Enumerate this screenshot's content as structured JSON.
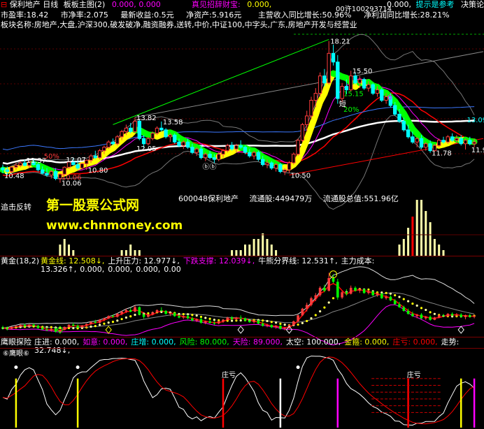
{
  "colors": {
    "up": "#ff3c3c",
    "down": "#00ffff",
    "gold": "#ffff00",
    "green": "#00ff00",
    "white": "#ffffff",
    "magenta": "#ff00ff",
    "red": "#ff0000",
    "yellow": "#ffff00",
    "blue": "#3c78ff"
  },
  "title": {
    "stock": "保利地产",
    "period": "日线",
    "indicator": "板板主图(2)",
    "p1": "0.000,",
    "p2": "0.000",
    "mid": "真见招辞财宝:",
    "code": "0.000,",
    "r1": "0.000,",
    "hint": "提示是参考",
    "right": "决策论"
  },
  "info1": {
    "pe": "市盈率:18.42",
    "pb": "市净率:2.075",
    "eps": "最新收益:0.5元",
    "nav": "净资产:5.916元",
    "rev": "主营收入同比增长:50.96%",
    "profit": "净利润同比增长:28.21%",
    "extra": "00许100293714"
  },
  "info2": "板块名称:房地产,大盘,沪深300,破发破净,融资融券,送转,中价,中证100,中字头,广东,房地产开发与经营业",
  "watermark": {
    "brand": "第一股票公式网",
    "url": "www.chnmoney.com"
  },
  "stockinfo": {
    "code": "600048保利地产",
    "float": "流通股:449479万",
    "cap": "流通股总值:551.96亿"
  },
  "vol_label": "追击反转",
  "gold_panel": {
    "label": "黄金(18,2)",
    "items": [
      {
        "t": "黄金线: 12.508↓,",
        "c": "#ffff00"
      },
      {
        "t": "上升压力: 12.977↓,",
        "c": "#ffffff"
      },
      {
        "t": "下跌支撑: 12.039↓,",
        "c": "#ff00ff"
      },
      {
        "t": "牛熊分界线: 12.531↑,",
        "c": "#ffffff"
      },
      {
        "t": "主力成本: 13.326↑,",
        "c": "#ffffff"
      },
      {
        "t": "0.000,",
        "c": "#ffffff"
      },
      {
        "t": "0.000,",
        "c": "#ffffff"
      },
      {
        "t": "0.000,",
        "c": "#ffffff"
      },
      {
        "t": "0.00",
        "c": "#ffffff"
      }
    ]
  },
  "eagle_panel": {
    "label": "鹰眼探险",
    "items": [
      {
        "t": "庄进: 0.000,",
        "c": "#ffffff"
      },
      {
        "t": "如意: 0.000,",
        "c": "#ff00ff"
      },
      {
        "t": "庄增: 0.000,",
        "c": "#00ffff"
      },
      {
        "t": "风险: 80.000,",
        "c": "#00ff00"
      },
      {
        "t": "天险: 89.000,",
        "c": "#ff00ff"
      },
      {
        "t": "太空: 100.000,",
        "c": "#ffffff"
      },
      {
        "t": "金箍: 0.000,",
        "c": "#ffff00"
      },
      {
        "t": "庄亏: 0.000,",
        "c": "#ff0000"
      },
      {
        "t": "走势: 32.748↓,",
        "c": "#ffffff"
      }
    ]
  },
  "eagle_label": "⑥鹰眼⑥",
  "chart_data": [
    {
      "type": "candlestick",
      "title": "保利地产 日线",
      "ylim": [
        10.2,
        18.8
      ],
      "annotations": [
        {
          "x": 0,
          "y": 10.48,
          "text": "10.48",
          "color": "#ffffff"
        },
        {
          "x": 5,
          "y": 11.37,
          "text": "11.37",
          "color": "#ffffff"
        },
        {
          "x": 9,
          "y": 11.6,
          "text": "50%",
          "color": "#ff3c3c"
        },
        {
          "x": 13,
          "y": 10.06,
          "text": "10.06",
          "color": "#ffffff"
        },
        {
          "x": 13,
          "y": 10.4,
          "text": "10.06",
          "color": "#ff3c3c"
        },
        {
          "x": 14,
          "y": 11.4,
          "text": "12.07",
          "color": "#ffffff"
        },
        {
          "x": 19,
          "y": 10.8,
          "text": "10.80",
          "color": "#ffffff"
        },
        {
          "x": 30,
          "y": 13.82,
          "text": "13.82",
          "color": "#ffffff"
        },
        {
          "x": 30,
          "y": 12.05,
          "text": "12.05",
          "color": "#ffffff"
        },
        {
          "x": 36,
          "y": 13.58,
          "text": "13.58",
          "color": "#ffffff"
        },
        {
          "x": 45,
          "y": 11.0,
          "text": "ⓑⓑ",
          "color": "#ffffff"
        },
        {
          "x": 65,
          "y": 10.5,
          "text": "10.50",
          "color": "#ffffff"
        },
        {
          "x": 74,
          "y": 18.21,
          "text": "18.21",
          "color": "#ffffff"
        },
        {
          "x": 76,
          "y": 14.6,
          "text": "短",
          "color": "#ffffff"
        },
        {
          "x": 77,
          "y": 15.2,
          "text": "15.15",
          "color": "#00ff00"
        },
        {
          "x": 77,
          "y": 14.3,
          "text": "20%",
          "color": "#00ff00"
        },
        {
          "x": 79,
          "y": 16.5,
          "text": "15.50",
          "color": "#ffffff"
        },
        {
          "x": 87,
          "y": 15.0,
          "text": "0",
          "color": "#ff00ff"
        },
        {
          "x": 97,
          "y": 11.78,
          "text": "11.78",
          "color": "#ffffff"
        },
        {
          "x": 105,
          "y": 13.7,
          "text": "13.09",
          "color": "#00ffff"
        },
        {
          "x": 106,
          "y": 11.97,
          "text": "11.97",
          "color": "#ffffff"
        }
      ],
      "series": [
        {
          "name": "",
          "type": "ohlc",
          "values": [
            [
              10.9,
              11.1,
              10.6,
              10.8
            ],
            [
              10.8,
              11.0,
              10.48,
              10.7
            ],
            [
              10.7,
              11.0,
              10.6,
              10.95
            ],
            [
              10.95,
              11.2,
              10.8,
              11.05
            ],
            [
              11.05,
              11.3,
              10.95,
              11.2
            ],
            [
              11.2,
              11.37,
              11.0,
              11.05
            ],
            [
              11.05,
              11.3,
              10.9,
              11.25
            ],
            [
              11.25,
              11.4,
              11.05,
              11.1
            ],
            [
              11.1,
              11.2,
              10.7,
              10.8
            ],
            [
              10.8,
              11.0,
              10.55,
              10.6
            ],
            [
              10.6,
              10.9,
              10.4,
              10.5
            ],
            [
              10.5,
              10.8,
              10.3,
              10.7
            ],
            [
              10.7,
              10.9,
              10.2,
              10.3
            ],
            [
              10.3,
              10.6,
              10.06,
              10.55
            ],
            [
              10.55,
              11.0,
              10.5,
              10.95
            ],
            [
              10.95,
              11.3,
              10.85,
              11.25
            ],
            [
              11.25,
              11.5,
              11.05,
              11.1
            ],
            [
              11.1,
              11.3,
              10.8,
              10.9
            ],
            [
              10.9,
              11.2,
              10.8,
              11.15
            ],
            [
              11.15,
              11.4,
              10.8,
              11.35
            ],
            [
              11.35,
              11.7,
              11.2,
              11.6
            ],
            [
              11.6,
              11.9,
              11.4,
              11.5
            ],
            [
              11.5,
              12.0,
              11.4,
              11.9
            ],
            [
              11.9,
              12.2,
              11.7,
              12.1
            ],
            [
              12.1,
              12.5,
              12.0,
              12.4
            ],
            [
              12.4,
              12.6,
              12.2,
              12.3
            ],
            [
              12.3,
              12.8,
              12.2,
              12.7
            ],
            [
              12.7,
              13.1,
              12.5,
              13.0
            ],
            [
              13.0,
              13.4,
              12.8,
              13.2
            ],
            [
              13.2,
              13.5,
              12.9,
              13.0
            ],
            [
              13.0,
              13.82,
              12.9,
              13.6
            ],
            [
              13.6,
              13.7,
              12.5,
              12.6
            ],
            [
              12.6,
              12.8,
              12.05,
              12.3
            ],
            [
              12.3,
              12.7,
              12.2,
              12.6
            ],
            [
              12.6,
              13.0,
              12.5,
              12.9
            ],
            [
              12.9,
              13.3,
              12.8,
              13.2
            ],
            [
              13.2,
              13.58,
              13.0,
              13.1
            ],
            [
              13.1,
              13.2,
              12.6,
              12.7
            ],
            [
              12.7,
              12.9,
              12.4,
              12.8
            ],
            [
              12.8,
              12.9,
              12.3,
              12.4
            ],
            [
              12.4,
              12.6,
              12.1,
              12.2
            ],
            [
              12.2,
              12.5,
              12.0,
              12.4
            ],
            [
              12.4,
              12.6,
              12.0,
              12.1
            ],
            [
              12.1,
              12.3,
              11.7,
              11.8
            ],
            [
              11.8,
              12.1,
              11.6,
              12.0
            ],
            [
              12.0,
              12.2,
              11.4,
              11.5
            ],
            [
              11.5,
              11.8,
              11.3,
              11.7
            ],
            [
              11.7,
              11.9,
              11.4,
              11.5
            ],
            [
              11.5,
              11.7,
              11.2,
              11.4
            ],
            [
              11.4,
              11.8,
              11.3,
              11.7
            ],
            [
              11.7,
              12.0,
              11.5,
              11.9
            ],
            [
              11.9,
              12.3,
              11.8,
              12.2
            ],
            [
              12.2,
              12.4,
              11.9,
              12.0
            ],
            [
              12.0,
              12.3,
              11.8,
              12.2
            ],
            [
              12.2,
              12.5,
              12.0,
              12.1
            ],
            [
              12.1,
              12.2,
              11.7,
              11.8
            ],
            [
              11.8,
              12.0,
              11.5,
              11.6
            ],
            [
              11.6,
              11.9,
              11.4,
              11.8
            ],
            [
              11.8,
              11.9,
              11.3,
              11.4
            ],
            [
              11.4,
              11.6,
              11.0,
              11.1
            ],
            [
              11.1,
              11.4,
              10.9,
              11.2
            ],
            [
              11.2,
              11.3,
              10.8,
              10.9
            ],
            [
              10.9,
              11.2,
              10.7,
              11.1
            ],
            [
              11.1,
              11.2,
              10.6,
              10.7
            ],
            [
              10.7,
              10.9,
              10.5,
              10.8
            ],
            [
              10.8,
              11.3,
              10.6,
              11.2
            ],
            [
              11.2,
              11.8,
              11.1,
              11.7
            ],
            [
              11.7,
              12.6,
              11.6,
              12.5
            ],
            [
              12.5,
              13.5,
              12.4,
              13.4
            ],
            [
              13.4,
              14.2,
              13.0,
              13.9
            ],
            [
              13.9,
              15.0,
              13.7,
              14.8
            ],
            [
              14.8,
              15.5,
              14.4,
              15.2
            ],
            [
              15.2,
              16.4,
              15.0,
              16.2
            ],
            [
              16.2,
              16.6,
              15.6,
              15.8
            ],
            [
              15.8,
              18.21,
              15.7,
              17.5
            ],
            [
              17.5,
              18.0,
              16.8,
              17.0
            ],
            [
              17.0,
              17.4,
              14.6,
              14.9
            ],
            [
              14.9,
              15.8,
              14.7,
              15.6
            ],
            [
              15.6,
              16.0,
              15.15,
              15.4
            ],
            [
              15.4,
              16.5,
              15.3,
              16.2
            ],
            [
              16.2,
              16.4,
              15.7,
              15.8
            ],
            [
              15.8,
              16.2,
              15.5,
              16.0
            ],
            [
              16.0,
              16.1,
              15.4,
              15.5
            ],
            [
              15.5,
              15.9,
              15.3,
              15.7
            ],
            [
              15.7,
              15.8,
              15.1,
              15.2
            ],
            [
              15.2,
              15.6,
              15.0,
              15.4
            ],
            [
              15.4,
              15.5,
              14.7,
              14.8
            ],
            [
              14.8,
              15.2,
              14.6,
              15.0
            ],
            [
              15.0,
              15.2,
              14.4,
              14.5
            ],
            [
              14.5,
              14.7,
              13.9,
              14.0
            ],
            [
              14.0,
              14.3,
              13.5,
              13.6
            ],
            [
              13.6,
              13.8,
              13.0,
              13.1
            ],
            [
              13.1,
              13.4,
              12.6,
              12.7
            ],
            [
              12.7,
              13.0,
              12.3,
              12.4
            ],
            [
              12.4,
              12.7,
              12.1,
              12.6
            ],
            [
              12.6,
              12.8,
              12.0,
              12.1
            ],
            [
              12.1,
              12.4,
              11.9,
              12.3
            ],
            [
              12.3,
              12.5,
              11.78,
              11.9
            ],
            [
              11.9,
              12.3,
              11.85,
              12.2
            ],
            [
              12.2,
              12.6,
              12.1,
              12.5
            ],
            [
              12.5,
              12.7,
              12.3,
              12.4
            ],
            [
              12.4,
              12.8,
              12.3,
              12.7
            ],
            [
              12.7,
              12.9,
              12.4,
              12.5
            ],
            [
              12.5,
              12.8,
              12.3,
              12.6
            ],
            [
              12.6,
              12.8,
              12.2,
              12.3
            ],
            [
              12.3,
              12.6,
              11.97,
              12.5
            ],
            [
              12.5,
              12.7,
              12.2,
              12.3
            ],
            [
              12.3,
              12.6,
              12.1,
              12.4
            ]
          ]
        }
      ]
    },
    {
      "type": "bar",
      "title": "",
      "values": [
        0,
        0,
        0,
        0,
        0,
        0,
        0,
        0,
        0,
        0,
        0,
        0,
        0,
        2,
        3,
        2,
        1,
        0,
        0,
        0,
        0,
        0,
        0,
        0,
        0,
        0,
        0,
        1,
        1,
        2,
        1,
        1,
        0,
        0,
        0,
        0,
        0,
        0,
        0,
        0,
        0,
        0,
        0,
        0,
        0,
        0,
        0,
        0,
        0,
        0,
        0,
        0,
        1,
        1,
        1,
        2,
        2,
        3,
        3,
        4,
        3,
        2,
        1,
        0,
        0,
        0,
        0,
        0,
        0,
        0,
        0,
        0,
        0,
        0,
        0,
        0,
        0,
        0,
        0,
        0,
        0,
        0,
        0,
        0,
        0,
        0,
        0,
        0,
        0,
        0,
        2,
        3,
        5,
        7,
        10,
        10,
        8,
        6,
        3,
        2,
        1,
        0,
        0,
        0,
        0,
        0,
        0,
        0
      ]
    },
    {
      "type": "line",
      "title": "黄金(18,2)",
      "series": [
        {
          "name": "黄金线",
          "values": []
        },
        {
          "name": "上升压力",
          "values": []
        },
        {
          "name": "下跌支撑",
          "values": []
        }
      ]
    },
    {
      "type": "line",
      "title": "鹰眼探险",
      "ylim": [
        0,
        100
      ],
      "series": [
        {
          "name": "走势",
          "values": []
        }
      ]
    }
  ]
}
